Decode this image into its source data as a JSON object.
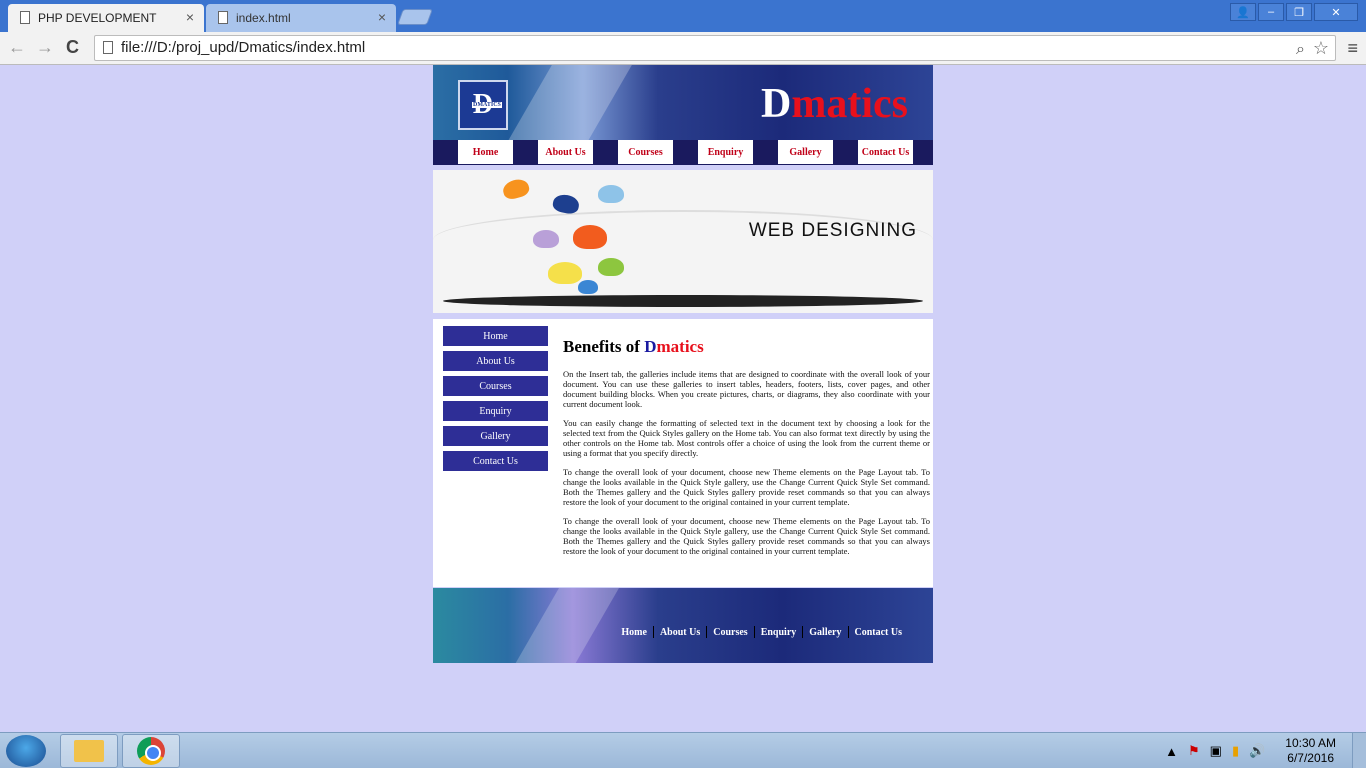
{
  "browser": {
    "tabs": [
      {
        "title": "PHP DEVELOPMENT",
        "close": "×"
      },
      {
        "title": "index.html",
        "close": "×"
      }
    ],
    "url": "file:///D:/proj_upd/Dmatics/index.html",
    "icons": {
      "back": "←",
      "forward": "→",
      "reload": "C",
      "zoom": "⌕",
      "star": "☆",
      "menu": "≡",
      "user": "👤",
      "minimize": "–",
      "maximize": "❐",
      "close": "✕"
    }
  },
  "site": {
    "brand_d": "D",
    "brand_rest": "matics",
    "logo_text": "D",
    "logo_small": "DMATICS",
    "topnav": [
      "Home",
      "About Us",
      "Courses",
      "Enquiry",
      "Gallery",
      "Contact Us"
    ],
    "banner_text": "WEB DESIGNING",
    "sidenav": [
      "Home",
      "About Us",
      "Courses",
      "Enquiry",
      "Gallery",
      "Contact Us"
    ],
    "heading_prefix": "Benefits of ",
    "heading_d": "D",
    "heading_rest": "matics",
    "paragraphs": [
      "On the Insert tab, the galleries include items that are designed to coordinate with the overall look of your document. You can use these galleries to insert tables, headers, footers, lists, cover pages, and other document building blocks. When you create pictures, charts, or diagrams, they also coordinate with your current document look.",
      "You can easily change the formatting of selected text in the document text by choosing a look for the selected text from the Quick Styles gallery on the Home tab. You can also format text directly by using the other controls on the Home tab. Most controls offer a choice of using the look from the current theme or using a format that you specify directly.",
      "To change the overall look of your document, choose new Theme elements on the Page Layout tab. To change the looks available in the Quick Style gallery, use the Change Current Quick Style Set command. Both the Themes gallery and the Quick Styles gallery provide reset commands so that you can always restore the look of your document to the original contained in your current template.",
      "To change the overall look of your document, choose new Theme elements on the Page Layout tab. To change the looks available in the Quick Style gallery, use the Change Current Quick Style Set command. Both the Themes gallery and the Quick Styles gallery provide reset commands so that you can always restore the look of your document to the original contained in your current template."
    ],
    "footnav": [
      "Home",
      "About Us",
      "Courses",
      "Enquiry",
      "Gallery",
      "Contact Us"
    ]
  },
  "taskbar": {
    "time": "10:30 AM",
    "date": "6/7/2016",
    "tray_icons": {
      "arrow": "▲",
      "flag": "⚑",
      "power": "▣",
      "signal": "▮",
      "volume": "🔊"
    }
  }
}
